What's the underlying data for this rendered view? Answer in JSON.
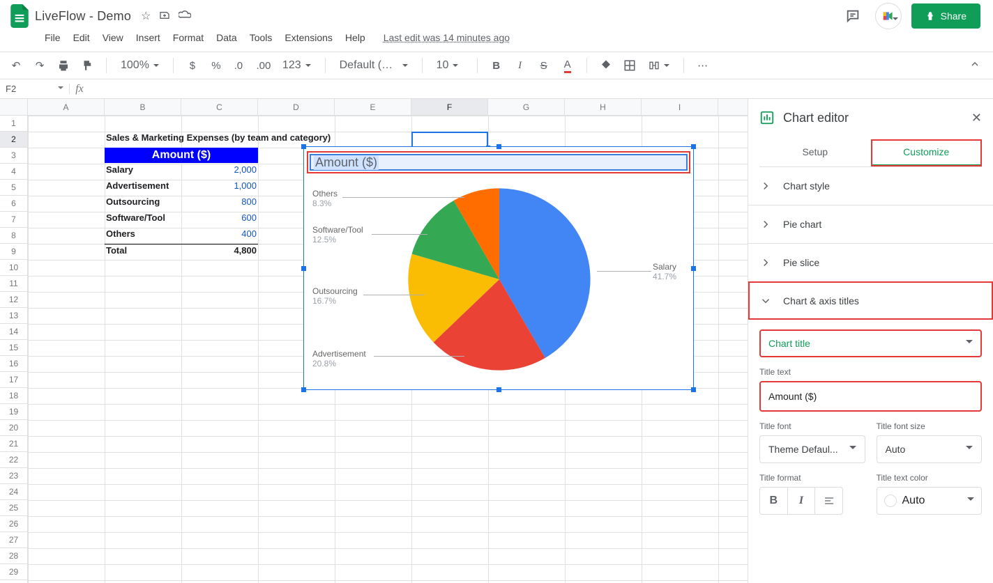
{
  "doc_title": "LiveFlow - Demo",
  "last_edit": "Last edit was 14 minutes ago",
  "menus": [
    "File",
    "Edit",
    "View",
    "Insert",
    "Format",
    "Data",
    "Tools",
    "Extensions",
    "Help"
  ],
  "share_label": "Share",
  "toolbar": {
    "zoom": "100%",
    "font": "Default (Ari...",
    "size": "10"
  },
  "namebox": "F2",
  "cols": [
    "A",
    "B",
    "C",
    "D",
    "E",
    "F",
    "G",
    "H",
    "I"
  ],
  "active_col": "F",
  "active_row": 2,
  "sheet": {
    "title": "Sales & Marketing Expenses (by team and category)",
    "header": "Amount ($)",
    "rows": [
      {
        "label": "Salary",
        "value": "2,000"
      },
      {
        "label": "Advertisement",
        "value": "1,000"
      },
      {
        "label": "Outsourcing",
        "value": "800"
      },
      {
        "label": "Software/Tool",
        "value": "600"
      },
      {
        "label": "Others",
        "value": "400"
      }
    ],
    "total_label": "Total",
    "total_value": "4,800"
  },
  "chart_data": {
    "type": "pie",
    "title": "Amount ($)",
    "categories": [
      "Salary",
      "Advertisement",
      "Outsourcing",
      "Software/Tool",
      "Others"
    ],
    "values": [
      2000,
      1000,
      800,
      600,
      400
    ],
    "percent_labels": [
      "41.7%",
      "20.8%",
      "16.7%",
      "12.5%",
      "8.3%"
    ],
    "colors": [
      "#4285f4",
      "#ea4335",
      "#fbbc04",
      "#34a853",
      "#ff6d01"
    ]
  },
  "panel": {
    "title": "Chart editor",
    "tabs": {
      "setup": "Setup",
      "customize": "Customize"
    },
    "sections": {
      "chart_style": "Chart style",
      "pie_chart": "Pie chart",
      "pie_slice": "Pie slice",
      "chart_axis": "Chart & axis titles"
    },
    "title_selector_label": "Chart title",
    "title_text_label": "Title text",
    "title_text_value": "Amount ($)",
    "title_font_label": "Title font",
    "title_font_value": "Theme Defaul...",
    "title_size_label": "Title font size",
    "title_size_value": "Auto",
    "title_format_label": "Title format",
    "title_color_label": "Title text color",
    "title_color_value": "Auto"
  }
}
